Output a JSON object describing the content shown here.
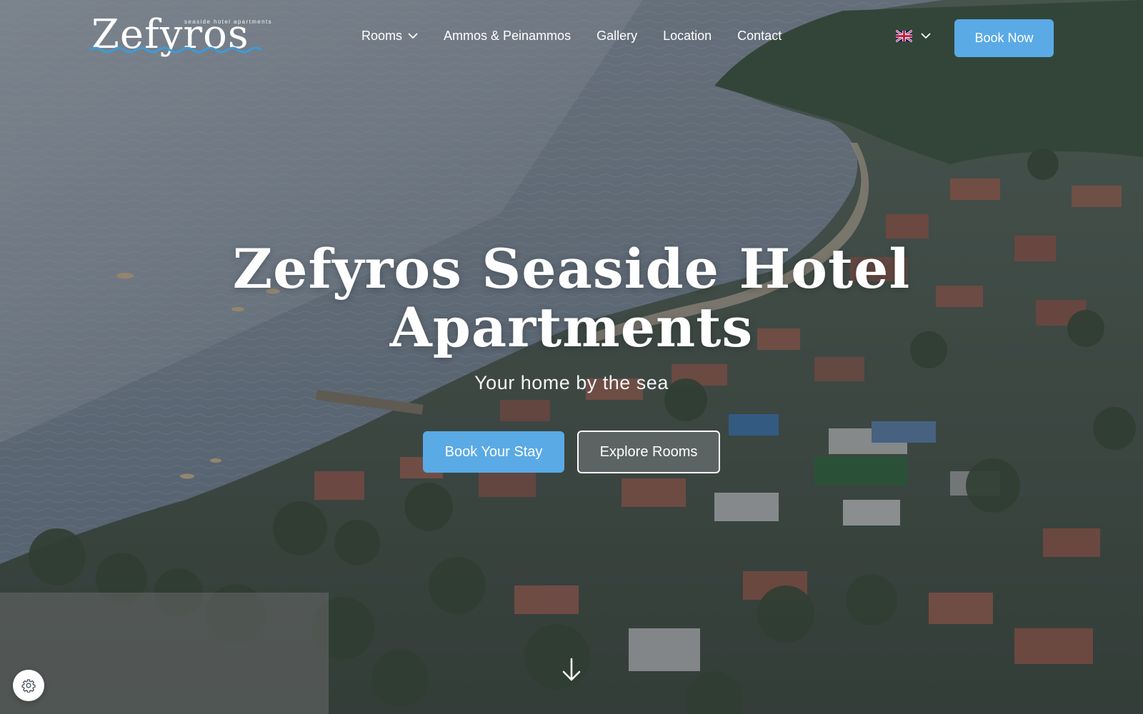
{
  "brand": {
    "logo_text": "Zefyros",
    "tagline": "seaside hotel apartments"
  },
  "header": {
    "nav": [
      {
        "label": "Rooms",
        "has_dropdown": true
      },
      {
        "label": "Ammos & Peinammos",
        "has_dropdown": false
      },
      {
        "label": "Gallery",
        "has_dropdown": false
      },
      {
        "label": "Location",
        "has_dropdown": false
      },
      {
        "label": "Contact",
        "has_dropdown": false
      }
    ],
    "language": {
      "icon": "uk-flag-icon",
      "dropdown_icon": "chevron-down-icon"
    },
    "book_now_label": "Book Now"
  },
  "hero": {
    "title_line1": "Zefyros Seaside Hotel",
    "title_line2": "Apartments",
    "subtitle": "Your home by the sea",
    "primary_cta": "Book Your Stay",
    "secondary_cta": "Explore Rooms",
    "scroll_icon": "arrow-down-icon",
    "background_image": "aerial view of a seaside village, bay and wooded hill"
  },
  "widgets": {
    "settings_icon": "gear-icon"
  },
  "colors": {
    "accent": "#5aaae6",
    "logo_wave": "#3d9bd8",
    "overlay": "#1c222c"
  }
}
